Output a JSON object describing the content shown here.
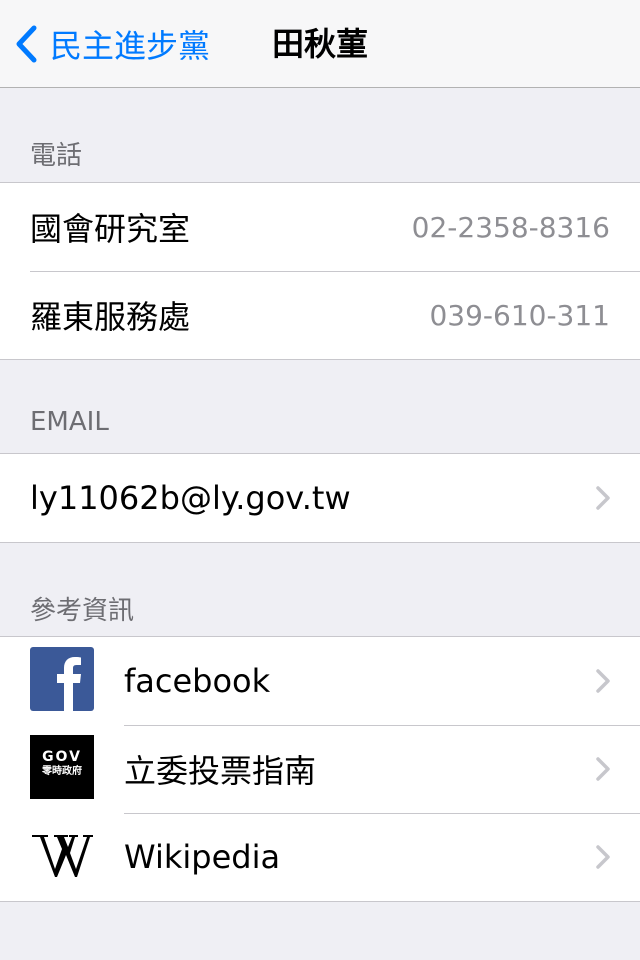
{
  "nav": {
    "back_label": "民主進步黨",
    "title": "田秋菫"
  },
  "phone": {
    "header": "電話",
    "items": [
      {
        "label": "國會研究室",
        "value": "02-2358-8316"
      },
      {
        "label": "羅東服務處",
        "value": "039-610-311"
      }
    ]
  },
  "email": {
    "header": "EMAIL",
    "address": "ly11062b@ly.gov.tw"
  },
  "references": {
    "header": "參考資訊",
    "items": [
      {
        "label": "facebook",
        "icon": "facebook-icon"
      },
      {
        "label": "立委投票指南",
        "icon": "gov-voting-guide-icon",
        "icon_text_top": "GOV",
        "icon_text_bottom": "零時政府"
      },
      {
        "label": "Wikipedia",
        "icon": "wikipedia-icon"
      }
    ]
  },
  "colors": {
    "accent": "#007aff",
    "background": "#efeff4",
    "secondary_text": "#8e8e93",
    "facebook": "#3b5998"
  }
}
